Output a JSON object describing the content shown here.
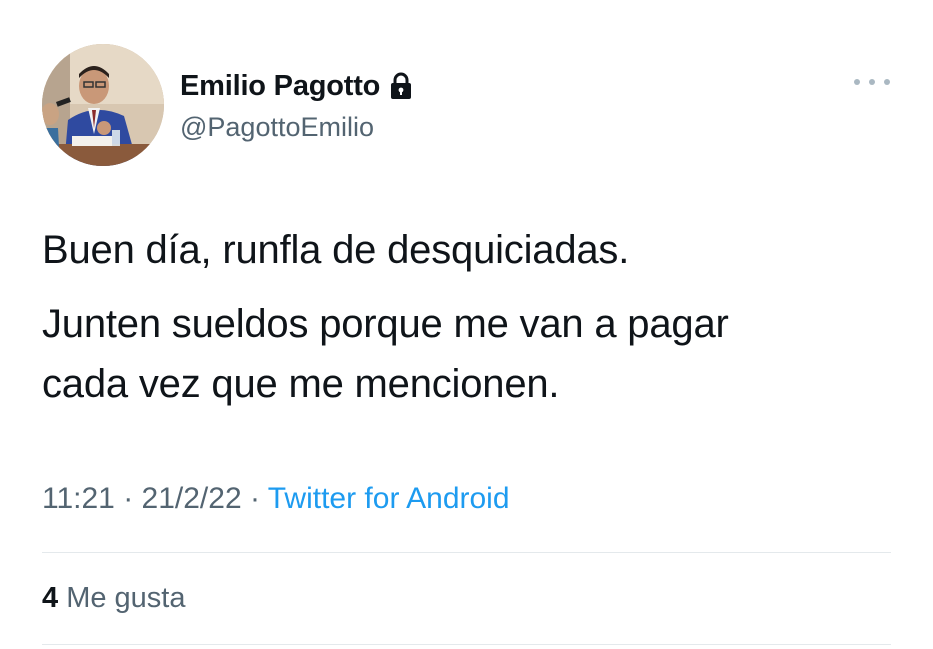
{
  "author": {
    "display_name": "Emilio Pagotto",
    "handle": "@PagottoEmilio",
    "avatar_icon": "profile-photo",
    "protected_icon": "lock-icon"
  },
  "tweet": {
    "paragraphs": [
      "Buen día, runfla de desquiciadas.",
      "Junten sueldos porque me van a pagar\ncada vez que me mencionen."
    ],
    "time": "11:21",
    "date": "21/2/22",
    "separator": " · ",
    "source": "Twitter for Android"
  },
  "stats": {
    "likes_count": "4",
    "likes_label": "Me gusta"
  },
  "menu": {
    "icon": "more-icon"
  },
  "colors": {
    "text": "#0f1419",
    "secondary": "#536471",
    "accent": "#1d9bf0",
    "divider": "#e4e9ec"
  }
}
